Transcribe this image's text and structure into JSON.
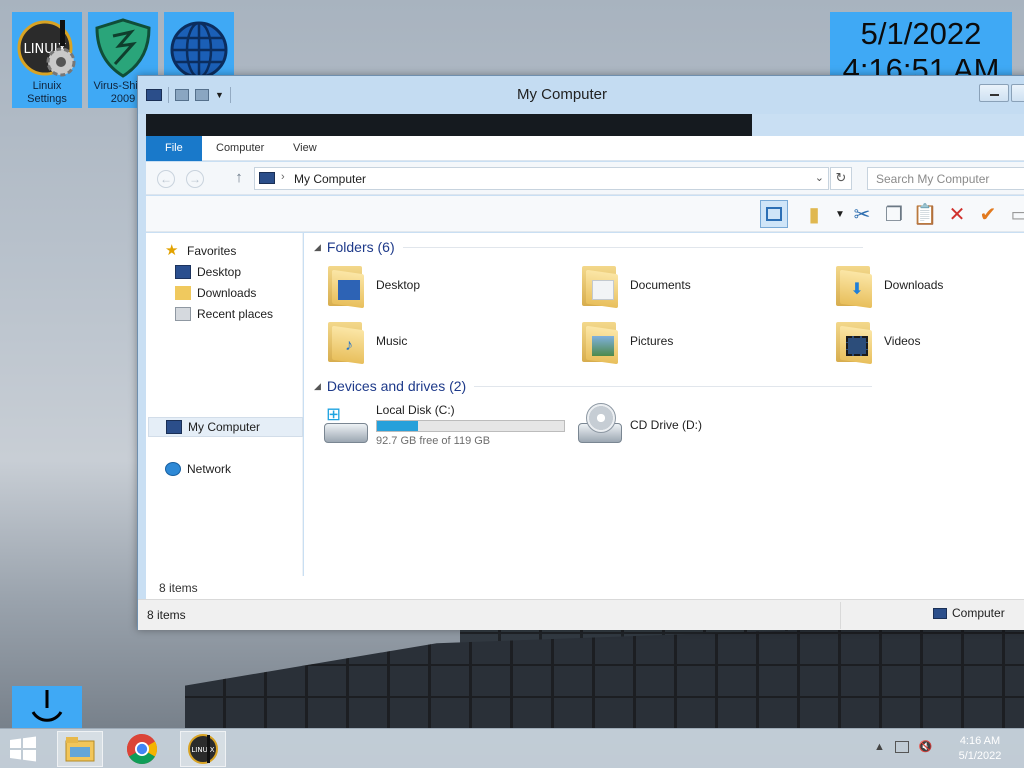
{
  "desktop": {
    "icons": [
      {
        "label": "Linuix Settings",
        "icon": "linuix-settings-icon"
      },
      {
        "label": "Virus-Shield 2009",
        "icon": "virus-shield-icon"
      },
      {
        "label": "",
        "icon": "globe-icon"
      }
    ],
    "clock_tile": {
      "date": "5/1/2022",
      "time": "4:16:51 AM"
    }
  },
  "window": {
    "title": "My Computer",
    "ribbon_tabs": [
      "File",
      "Computer",
      "View"
    ],
    "address": "My Computer",
    "search_placeholder": "Search My Computer",
    "nav_pane": {
      "favorites_label": "Favorites",
      "favorites": [
        "Desktop",
        "Downloads",
        "Recent places"
      ],
      "computer": "My Computer",
      "network": "Network"
    },
    "folders_header": "Folders (6)",
    "folders": [
      {
        "name": "Desktop",
        "icon": "desktop-folder-icon"
      },
      {
        "name": "Documents",
        "icon": "documents-folder-icon"
      },
      {
        "name": "Downloads",
        "icon": "downloads-folder-icon"
      },
      {
        "name": "Music",
        "icon": "music-folder-icon"
      },
      {
        "name": "Pictures",
        "icon": "pictures-folder-icon"
      },
      {
        "name": "Videos",
        "icon": "videos-folder-icon"
      }
    ],
    "drives_header": "Devices and drives (2)",
    "drives": [
      {
        "name": "Local Disk (C:)",
        "free_text": "92.7 GB free of 119 GB",
        "used_fraction": 0.221
      },
      {
        "name": "CD Drive (D:)"
      }
    ],
    "item_count": "8 items",
    "status_left": "8 items",
    "status_right": "Computer"
  },
  "taskbar": {
    "time": "4:16 AM",
    "date": "5/1/2022",
    "apps": [
      "file-explorer-icon",
      "chrome-icon",
      "linuix-icon"
    ]
  },
  "colors": {
    "accent": "#1979ca",
    "tile": "#3fa9f5",
    "drive_bar": "#26a0da"
  }
}
